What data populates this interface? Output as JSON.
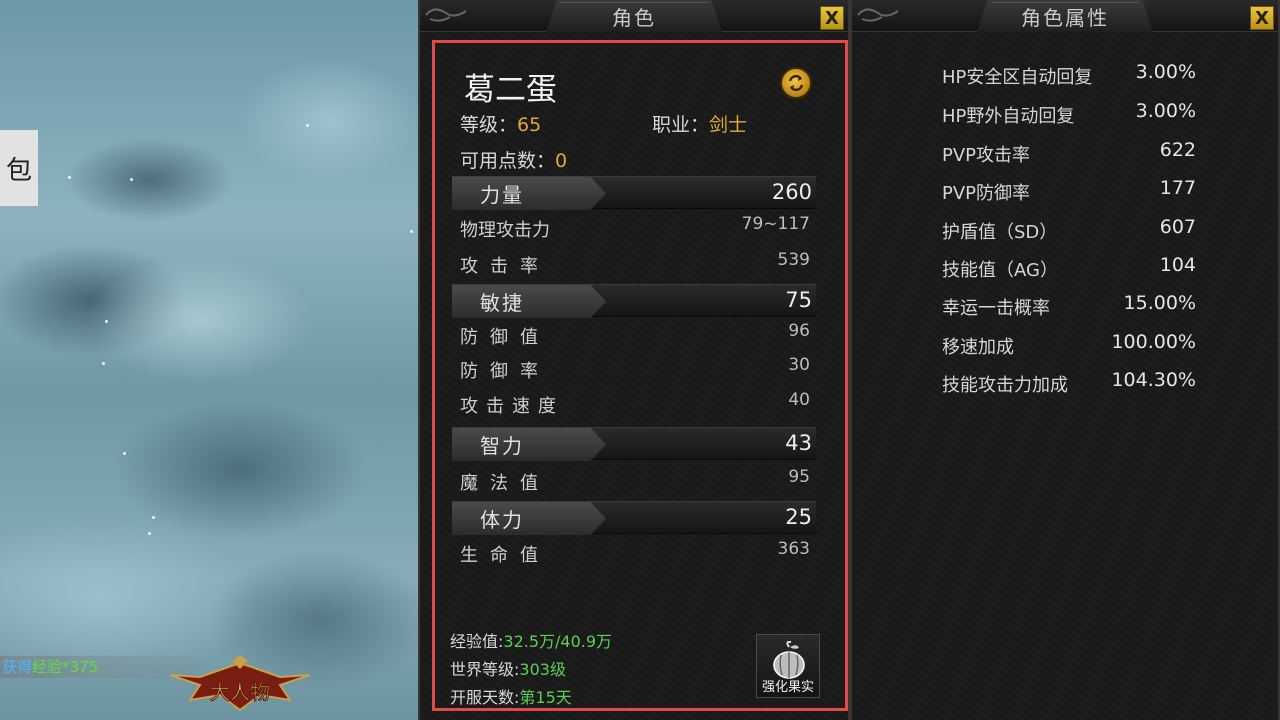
{
  "scene": {
    "side_tab": "包",
    "exp_message": {
      "prefix": "获得",
      "item": "经验",
      "amount": "*375"
    },
    "logo_text": "大人物"
  },
  "character_panel": {
    "title": "角色",
    "close": "X",
    "name": "葛二蛋",
    "level_label": "等级：",
    "level_value": "65",
    "class_label": "职业：",
    "class_value": "剑士",
    "points_label": "可用点数：",
    "points_value": "0",
    "stats": [
      {
        "label": "力量",
        "value": "260",
        "subs": [
          {
            "label": "物理攻击力",
            "value": "79~117"
          },
          {
            "label": "攻击率",
            "value": "539"
          }
        ]
      },
      {
        "label": "敏捷",
        "value": "75",
        "subs": [
          {
            "label": "防御值",
            "value": "96"
          },
          {
            "label": "防御率",
            "value": "30"
          },
          {
            "label": "攻击速度",
            "value": "40"
          }
        ]
      },
      {
        "label": "智力",
        "value": "43",
        "subs": [
          {
            "label": "魔法值",
            "value": "95"
          }
        ]
      },
      {
        "label": "体力",
        "value": "25",
        "subs": [
          {
            "label": "生命值",
            "value": "363"
          }
        ]
      }
    ],
    "footer": {
      "exp_label": "经验值:",
      "exp_value": "32.5万/40.9万",
      "world_level_label": "世界等级:",
      "world_level_value": "303级",
      "server_days_label": "开服天数:",
      "server_days_value": "第15天"
    },
    "fruit_button": "强化果实"
  },
  "attributes_panel": {
    "title": "角色属性",
    "close": "X",
    "rows": [
      {
        "label": "HP安全区自动回复",
        "value": "3.00%"
      },
      {
        "label": "HP野外自动回复",
        "value": "3.00%"
      },
      {
        "label": "PVP攻击率",
        "value": "622"
      },
      {
        "label": "PVP防御率",
        "value": "177"
      },
      {
        "label": "护盾值（SD）",
        "value": "607"
      },
      {
        "label": "技能值（AG）",
        "value": "104"
      },
      {
        "label": "幸运一击概率",
        "value": "15.00%"
      },
      {
        "label": "移速加成",
        "value": "100.00%"
      },
      {
        "label": "技能攻击力加成",
        "value": "104.30%"
      }
    ]
  },
  "colors": {
    "gold": "#e0a838",
    "green": "#5ccf55",
    "highlight": "#e24a4a",
    "close_btn": "#e9c642"
  }
}
